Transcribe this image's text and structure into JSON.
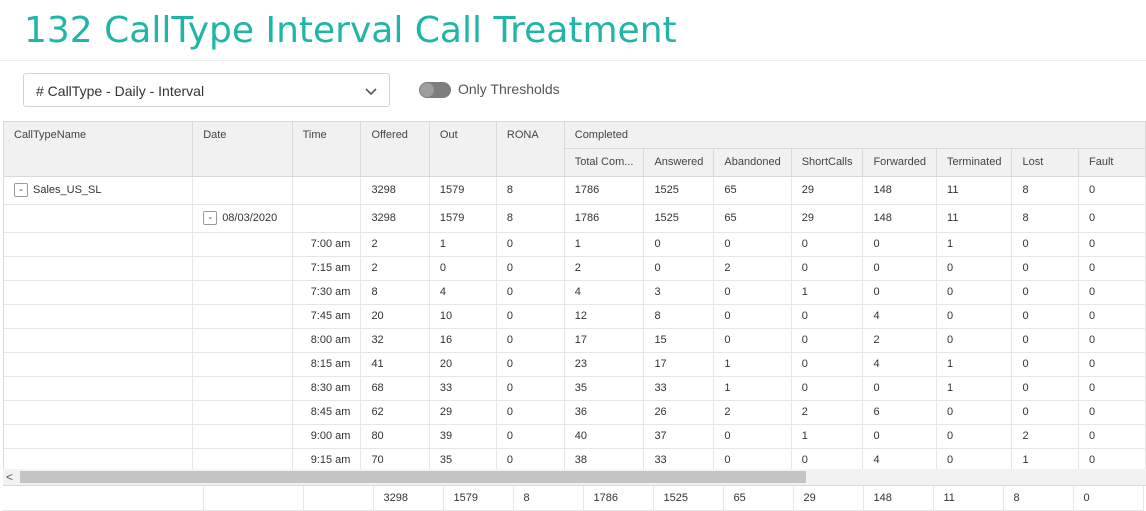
{
  "page": {
    "title": "132 CallType Interval Call Treatment"
  },
  "filter": {
    "selected": "# CallType - Daily - Interval",
    "thresholds_label": "Only Thresholds",
    "thresholds_on": false
  },
  "grid": {
    "headers": {
      "calltype": "CallTypeName",
      "date": "Date",
      "time": "Time",
      "offered": "Offered",
      "out": "Out",
      "rona": "RONA",
      "completed": "Completed",
      "total_completed": "Total Com...",
      "answered": "Answered",
      "abandoned": "Abandoned",
      "shortcalls": "ShortCalls",
      "forwarded": "Forwarded",
      "terminated": "Terminated",
      "lost": "Lost",
      "fault": "Fault"
    },
    "group_row": {
      "toggle": "-",
      "name": "Sales_US_SL",
      "values": [
        "3298",
        "1579",
        "8",
        "1786",
        "1525",
        "65",
        "29",
        "148",
        "11",
        "8",
        "0"
      ]
    },
    "date_row": {
      "toggle": "-",
      "date": "08/03/2020",
      "values": [
        "3298",
        "1579",
        "8",
        "1786",
        "1525",
        "65",
        "29",
        "148",
        "11",
        "8",
        "0"
      ]
    },
    "rows": [
      {
        "time": "7:00 am",
        "values": [
          "2",
          "1",
          "0",
          "1",
          "0",
          "0",
          "0",
          "0",
          "1",
          "0",
          "0"
        ]
      },
      {
        "time": "7:15 am",
        "values": [
          "2",
          "0",
          "0",
          "2",
          "0",
          "2",
          "0",
          "0",
          "0",
          "0",
          "0"
        ]
      },
      {
        "time": "7:30 am",
        "values": [
          "8",
          "4",
          "0",
          "4",
          "3",
          "0",
          "1",
          "0",
          "0",
          "0",
          "0"
        ]
      },
      {
        "time": "7:45 am",
        "values": [
          "20",
          "10",
          "0",
          "12",
          "8",
          "0",
          "0",
          "4",
          "0",
          "0",
          "0"
        ]
      },
      {
        "time": "8:00 am",
        "values": [
          "32",
          "16",
          "0",
          "17",
          "15",
          "0",
          "0",
          "2",
          "0",
          "0",
          "0"
        ]
      },
      {
        "time": "8:15 am",
        "values": [
          "41",
          "20",
          "0",
          "23",
          "17",
          "1",
          "0",
          "4",
          "1",
          "0",
          "0"
        ]
      },
      {
        "time": "8:30 am",
        "values": [
          "68",
          "33",
          "0",
          "35",
          "33",
          "1",
          "0",
          "0",
          "1",
          "0",
          "0"
        ]
      },
      {
        "time": "8:45 am",
        "values": [
          "62",
          "29",
          "0",
          "36",
          "26",
          "2",
          "2",
          "6",
          "0",
          "0",
          "0"
        ]
      },
      {
        "time": "9:00 am",
        "values": [
          "80",
          "39",
          "0",
          "40",
          "37",
          "0",
          "1",
          "0",
          "0",
          "2",
          "0"
        ]
      },
      {
        "time": "9:15 am",
        "values": [
          "70",
          "35",
          "0",
          "38",
          "33",
          "0",
          "0",
          "4",
          "0",
          "1",
          "0"
        ]
      }
    ],
    "totals": [
      "3298",
      "1579",
      "8",
      "1786",
      "1525",
      "65",
      "29",
      "148",
      "11",
      "8",
      "0"
    ],
    "scroll_left_glyph": "<"
  }
}
